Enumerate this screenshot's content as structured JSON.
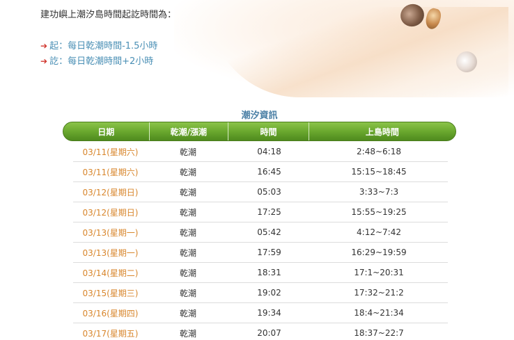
{
  "intro": "建功嶼上潮汐島時間起訖時間為：",
  "rules": [
    {
      "text": "起：每日乾潮時間-1.5小時"
    },
    {
      "text": "訖：每日乾潮時間+2小時"
    }
  ],
  "table": {
    "title": "潮汐資訊",
    "headers": [
      "日期",
      "乾潮/漲潮",
      "時間",
      "上島時間"
    ],
    "rows": [
      {
        "date": "03/11(星期六)",
        "tide": "乾潮",
        "time": "04:18",
        "window": "2:48~6:18"
      },
      {
        "date": "03/11(星期六)",
        "tide": "乾潮",
        "time": "16:45",
        "window": "15:15~18:45"
      },
      {
        "date": "03/12(星期日)",
        "tide": "乾潮",
        "time": "05:03",
        "window": "3:33~7:3"
      },
      {
        "date": "03/12(星期日)",
        "tide": "乾潮",
        "time": "17:25",
        "window": "15:55~19:25"
      },
      {
        "date": "03/13(星期一)",
        "tide": "乾潮",
        "time": "05:42",
        "window": "4:12~7:42"
      },
      {
        "date": "03/13(星期一)",
        "tide": "乾潮",
        "time": "17:59",
        "window": "16:29~19:59"
      },
      {
        "date": "03/14(星期二)",
        "tide": "乾潮",
        "time": "18:31",
        "window": "17:1~20:31"
      },
      {
        "date": "03/15(星期三)",
        "tide": "乾潮",
        "time": "19:02",
        "window": "17:32~21:2"
      },
      {
        "date": "03/16(星期四)",
        "tide": "乾潮",
        "time": "19:34",
        "window": "18:4~21:34"
      },
      {
        "date": "03/17(星期五)",
        "tide": "乾潮",
        "time": "20:07",
        "window": "18:37~22:7"
      }
    ]
  },
  "colors": {
    "header_green": "#6aa82e",
    "date_orange": "#d8862c",
    "title_blue": "#4a7fa5",
    "rule_blue": "#4a8fb5",
    "arrow_red": "#d0342c"
  },
  "icons": [
    "arrow-icon",
    "seashell-icon"
  ]
}
